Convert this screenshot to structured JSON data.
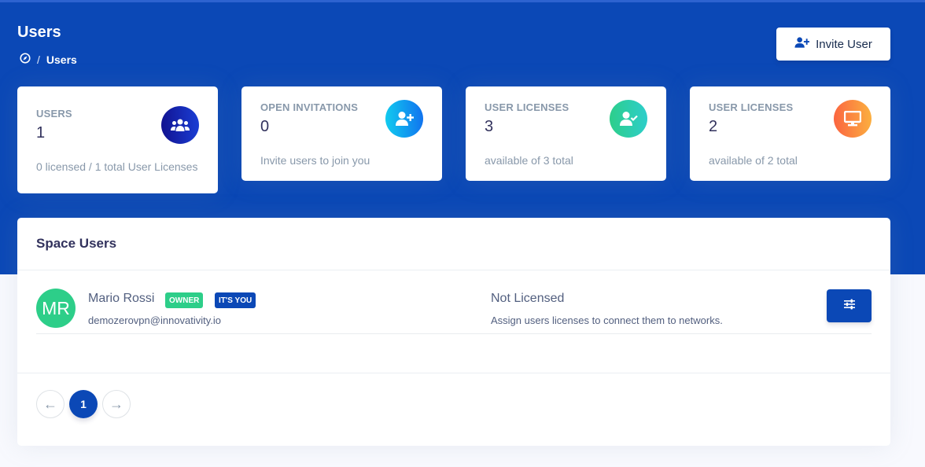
{
  "header": {
    "title": "Users",
    "breadcrumb_separator": "/",
    "breadcrumb_current": "Users",
    "invite_label": "Invite User"
  },
  "stats": [
    {
      "label": "USERS",
      "value": "1",
      "sub": "0 licensed / 1 total User Licenses",
      "icon": "users-icon",
      "color": "#1a2bb0"
    },
    {
      "label": "OPEN INVITATIONS",
      "value": "0",
      "sub": "Invite users to join you",
      "icon": "user-plus-icon",
      "color": "#11a6ef"
    },
    {
      "label": "USER LICENSES",
      "value": "3",
      "sub": "available of 3 total",
      "icon": "user-check-icon",
      "color": "#2dce89"
    },
    {
      "label": "USER LICENSES",
      "value": "2",
      "sub": "available of 2 total",
      "icon": "monitor-icon",
      "color": "#fb6340"
    }
  ],
  "panel": {
    "title": "Space Users",
    "users": [
      {
        "initials": "MR",
        "name": "Mario Rossi",
        "badges": [
          "OWNER",
          "IT'S YOU"
        ],
        "email": "demozerovpn@innovativity.io",
        "license_status": "Not Licensed",
        "license_hint": "Assign users licenses to connect them to networks."
      }
    ]
  },
  "pagination": {
    "prev": "←",
    "current": "1",
    "next": "→"
  },
  "colors": {
    "brand": "#0b48b6",
    "owner_badge": "#2dce89",
    "you_badge": "#0b48b6"
  }
}
